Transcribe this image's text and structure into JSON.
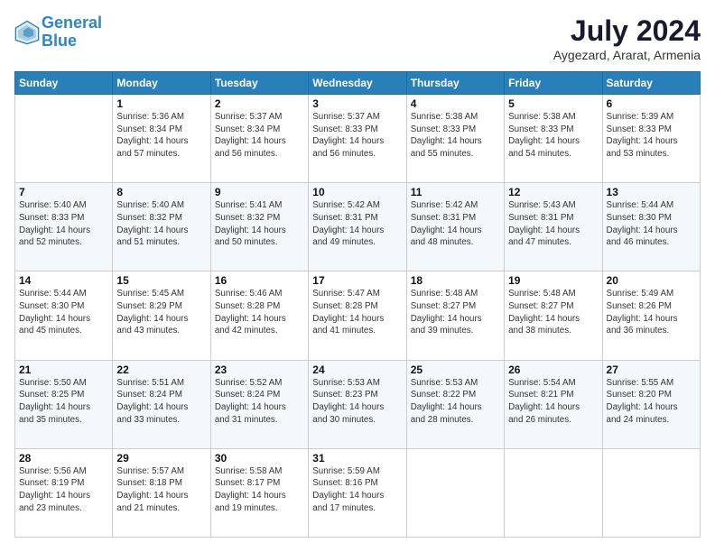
{
  "header": {
    "logo_line1": "General",
    "logo_line2": "Blue",
    "title": "July 2024",
    "subtitle": "Aygezard, Ararat, Armenia"
  },
  "columns": [
    "Sunday",
    "Monday",
    "Tuesday",
    "Wednesday",
    "Thursday",
    "Friday",
    "Saturday"
  ],
  "weeks": [
    [
      {
        "day": "",
        "info": ""
      },
      {
        "day": "1",
        "info": "Sunrise: 5:36 AM\nSunset: 8:34 PM\nDaylight: 14 hours\nand 57 minutes."
      },
      {
        "day": "2",
        "info": "Sunrise: 5:37 AM\nSunset: 8:34 PM\nDaylight: 14 hours\nand 56 minutes."
      },
      {
        "day": "3",
        "info": "Sunrise: 5:37 AM\nSunset: 8:33 PM\nDaylight: 14 hours\nand 56 minutes."
      },
      {
        "day": "4",
        "info": "Sunrise: 5:38 AM\nSunset: 8:33 PM\nDaylight: 14 hours\nand 55 minutes."
      },
      {
        "day": "5",
        "info": "Sunrise: 5:38 AM\nSunset: 8:33 PM\nDaylight: 14 hours\nand 54 minutes."
      },
      {
        "day": "6",
        "info": "Sunrise: 5:39 AM\nSunset: 8:33 PM\nDaylight: 14 hours\nand 53 minutes."
      }
    ],
    [
      {
        "day": "7",
        "info": "Sunrise: 5:40 AM\nSunset: 8:33 PM\nDaylight: 14 hours\nand 52 minutes."
      },
      {
        "day": "8",
        "info": "Sunrise: 5:40 AM\nSunset: 8:32 PM\nDaylight: 14 hours\nand 51 minutes."
      },
      {
        "day": "9",
        "info": "Sunrise: 5:41 AM\nSunset: 8:32 PM\nDaylight: 14 hours\nand 50 minutes."
      },
      {
        "day": "10",
        "info": "Sunrise: 5:42 AM\nSunset: 8:31 PM\nDaylight: 14 hours\nand 49 minutes."
      },
      {
        "day": "11",
        "info": "Sunrise: 5:42 AM\nSunset: 8:31 PM\nDaylight: 14 hours\nand 48 minutes."
      },
      {
        "day": "12",
        "info": "Sunrise: 5:43 AM\nSunset: 8:31 PM\nDaylight: 14 hours\nand 47 minutes."
      },
      {
        "day": "13",
        "info": "Sunrise: 5:44 AM\nSunset: 8:30 PM\nDaylight: 14 hours\nand 46 minutes."
      }
    ],
    [
      {
        "day": "14",
        "info": "Sunrise: 5:44 AM\nSunset: 8:30 PM\nDaylight: 14 hours\nand 45 minutes."
      },
      {
        "day": "15",
        "info": "Sunrise: 5:45 AM\nSunset: 8:29 PM\nDaylight: 14 hours\nand 43 minutes."
      },
      {
        "day": "16",
        "info": "Sunrise: 5:46 AM\nSunset: 8:28 PM\nDaylight: 14 hours\nand 42 minutes."
      },
      {
        "day": "17",
        "info": "Sunrise: 5:47 AM\nSunset: 8:28 PM\nDaylight: 14 hours\nand 41 minutes."
      },
      {
        "day": "18",
        "info": "Sunrise: 5:48 AM\nSunset: 8:27 PM\nDaylight: 14 hours\nand 39 minutes."
      },
      {
        "day": "19",
        "info": "Sunrise: 5:48 AM\nSunset: 8:27 PM\nDaylight: 14 hours\nand 38 minutes."
      },
      {
        "day": "20",
        "info": "Sunrise: 5:49 AM\nSunset: 8:26 PM\nDaylight: 14 hours\nand 36 minutes."
      }
    ],
    [
      {
        "day": "21",
        "info": "Sunrise: 5:50 AM\nSunset: 8:25 PM\nDaylight: 14 hours\nand 35 minutes."
      },
      {
        "day": "22",
        "info": "Sunrise: 5:51 AM\nSunset: 8:24 PM\nDaylight: 14 hours\nand 33 minutes."
      },
      {
        "day": "23",
        "info": "Sunrise: 5:52 AM\nSunset: 8:24 PM\nDaylight: 14 hours\nand 31 minutes."
      },
      {
        "day": "24",
        "info": "Sunrise: 5:53 AM\nSunset: 8:23 PM\nDaylight: 14 hours\nand 30 minutes."
      },
      {
        "day": "25",
        "info": "Sunrise: 5:53 AM\nSunset: 8:22 PM\nDaylight: 14 hours\nand 28 minutes."
      },
      {
        "day": "26",
        "info": "Sunrise: 5:54 AM\nSunset: 8:21 PM\nDaylight: 14 hours\nand 26 minutes."
      },
      {
        "day": "27",
        "info": "Sunrise: 5:55 AM\nSunset: 8:20 PM\nDaylight: 14 hours\nand 24 minutes."
      }
    ],
    [
      {
        "day": "28",
        "info": "Sunrise: 5:56 AM\nSunset: 8:19 PM\nDaylight: 14 hours\nand 23 minutes."
      },
      {
        "day": "29",
        "info": "Sunrise: 5:57 AM\nSunset: 8:18 PM\nDaylight: 14 hours\nand 21 minutes."
      },
      {
        "day": "30",
        "info": "Sunrise: 5:58 AM\nSunset: 8:17 PM\nDaylight: 14 hours\nand 19 minutes."
      },
      {
        "day": "31",
        "info": "Sunrise: 5:59 AM\nSunset: 8:16 PM\nDaylight: 14 hours\nand 17 minutes."
      },
      {
        "day": "",
        "info": ""
      },
      {
        "day": "",
        "info": ""
      },
      {
        "day": "",
        "info": ""
      }
    ]
  ]
}
